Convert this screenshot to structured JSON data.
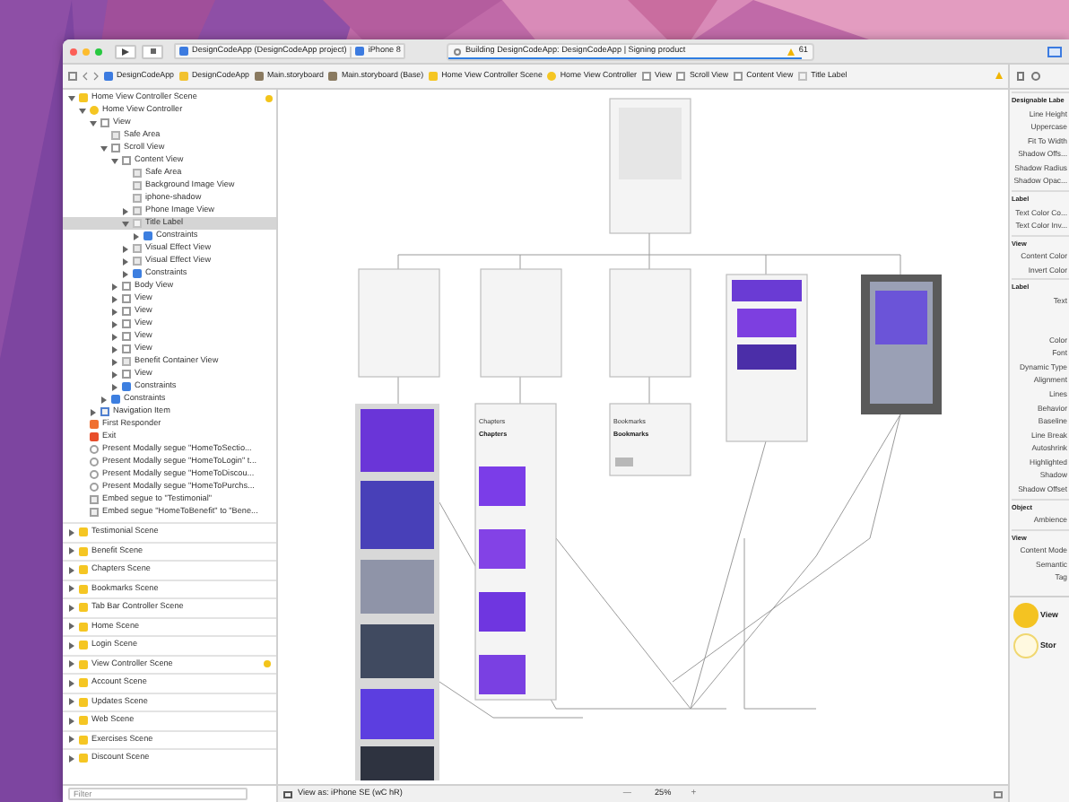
{
  "toolbar": {
    "scheme": "DesignCodeApp (DesignCodeApp project)",
    "device": "iPhone 8",
    "activity": "Building DesignCodeApp: DesignCodeApp | Signing product",
    "level": 0.97,
    "warnings": "61"
  },
  "breadcrumbs": [
    {
      "label": "DesignCodeApp",
      "kind": "project"
    },
    {
      "label": "DesignCodeApp",
      "kind": "folder"
    },
    {
      "label": "Main.storyboard",
      "kind": "file"
    },
    {
      "label": "Main.storyboard (Base)",
      "kind": "file"
    },
    {
      "label": "Home View Controller Scene",
      "kind": "scene"
    },
    {
      "label": "Home View Controller",
      "kind": "controller"
    },
    {
      "label": "View",
      "kind": "view"
    },
    {
      "label": "Scroll View",
      "kind": "view"
    },
    {
      "label": "Content View",
      "kind": "view"
    },
    {
      "label": "Title Label",
      "kind": "label"
    }
  ],
  "outline": {
    "tree": [
      {
        "label": "Home View Controller Scene",
        "kind": "scene",
        "expanded": true,
        "warning": true,
        "selected": false,
        "children": [
          {
            "label": "Home View Controller",
            "kind": "controller",
            "expanded": true,
            "selected": false,
            "children": [
              {
                "label": "View",
                "kind": "view",
                "expanded": true,
                "selected": false,
                "children": [
                  {
                    "label": "Safe Area",
                    "kind": "guide",
                    "selected": false
                  },
                  {
                    "label": "Scroll View",
                    "kind": "view",
                    "expanded": true,
                    "selected": false,
                    "children": [
                      {
                        "label": "Content View",
                        "kind": "view",
                        "expanded": true,
                        "selected": false,
                        "children": [
                          {
                            "label": "Safe Area",
                            "kind": "guide",
                            "selected": false
                          },
                          {
                            "label": "Background Image View",
                            "kind": "guide",
                            "selected": false
                          },
                          {
                            "label": "iphone-shadow",
                            "kind": "guide",
                            "selected": false
                          },
                          {
                            "label": "Phone Image View",
                            "kind": "guide",
                            "expanded": false,
                            "selected": false
                          },
                          {
                            "label": "Title Label",
                            "kind": "label",
                            "expanded": true,
                            "selected": true,
                            "children": [
                              {
                                "label": "Constraints",
                                "kind": "constraints",
                                "expanded": false,
                                "selected": false
                              }
                            ]
                          },
                          {
                            "label": "Visual Effect View",
                            "kind": "guide",
                            "expanded": false,
                            "selected": false
                          },
                          {
                            "label": "Visual Effect View",
                            "kind": "guide",
                            "expanded": false,
                            "selected": false
                          },
                          {
                            "label": "Constraints",
                            "kind": "constraints",
                            "expanded": false,
                            "selected": false
                          }
                        ]
                      },
                      {
                        "label": "Body View",
                        "kind": "view",
                        "expanded": false,
                        "selected": false
                      },
                      {
                        "label": "View",
                        "kind": "view",
                        "expanded": false,
                        "selected": false
                      },
                      {
                        "label": "View",
                        "kind": "view",
                        "expanded": false,
                        "selected": false
                      },
                      {
                        "label": "View",
                        "kind": "view",
                        "expanded": false,
                        "selected": false
                      },
                      {
                        "label": "View",
                        "kind": "view",
                        "expanded": false,
                        "selected": false
                      },
                      {
                        "label": "View",
                        "kind": "view",
                        "expanded": false,
                        "selected": false
                      },
                      {
                        "label": "Benefit Container View",
                        "kind": "guide",
                        "expanded": false,
                        "selected": false
                      },
                      {
                        "label": "View",
                        "kind": "view",
                        "expanded": false,
                        "selected": false
                      },
                      {
                        "label": "Constraints",
                        "kind": "constraints",
                        "expanded": false,
                        "selected": false
                      }
                    ]
                  },
                  {
                    "label": "Constraints",
                    "kind": "constraints",
                    "expanded": false,
                    "selected": false
                  }
                ]
              },
              {
                "label": "Navigation Item",
                "kind": "navigation",
                "expanded": false,
                "selected": false
              }
            ]
          },
          {
            "label": "First Responder",
            "kind": "responder",
            "selected": false
          },
          {
            "label": "Exit",
            "kind": "exit",
            "selected": false
          },
          {
            "label": "Present Modally segue \"HomeToSectio...",
            "kind": "segue",
            "selected": false
          },
          {
            "label": "Present Modally segue \"HomeToLogin\" t...",
            "kind": "segue",
            "selected": false
          },
          {
            "label": "Present Modally segue \"HomeToDiscou...",
            "kind": "segue",
            "selected": false
          },
          {
            "label": "Present Modally segue \"HomeToPurchs...",
            "kind": "segue",
            "selected": false
          },
          {
            "label": "Embed segue to \"Testimonial\"",
            "kind": "embed",
            "selected": false
          },
          {
            "label": "Embed segue \"HomeToBenefit\" to \"Bene...",
            "kind": "embed",
            "selected": false
          }
        ]
      }
    ],
    "scenes": [
      {
        "label": "Testimonial Scene",
        "warning": false
      },
      {
        "label": "Benefit Scene",
        "warning": false
      },
      {
        "label": "Chapters Scene",
        "warning": false
      },
      {
        "label": "Bookmarks Scene",
        "warning": false
      },
      {
        "label": "Tab Bar Controller Scene",
        "warning": false
      },
      {
        "label": "Home Scene",
        "warning": false
      },
      {
        "label": "Login Scene",
        "warning": false
      },
      {
        "label": "View Controller Scene",
        "warning": true
      },
      {
        "label": "Account Scene",
        "warning": false
      },
      {
        "label": "Updates Scene",
        "warning": false
      },
      {
        "label": "Web Scene",
        "warning": false
      },
      {
        "label": "Exercises Scene",
        "warning": false
      },
      {
        "label": "Discount Scene",
        "warning": false
      }
    ],
    "filter": {
      "placeholder": "Filter"
    }
  },
  "canvas": {
    "scenes": [
      {
        "title": "Chapters",
        "heading": "Chapters"
      },
      {
        "title": "Bookmarks",
        "heading": "Bookmarks"
      }
    ]
  },
  "bottom_bar": {
    "view_as": "View as: iPhone SE (wC hR)",
    "zoom_out": "—",
    "zoom": "25%",
    "zoom_in": "+"
  },
  "inspector": {
    "rows": [
      {
        "kind": "header",
        "label": "Designable Labe"
      },
      {
        "kind": "row",
        "label": "Line Height"
      },
      {
        "kind": "row",
        "label": "Uppercase"
      },
      {
        "kind": "row",
        "label": "Fit To Width"
      },
      {
        "kind": "row",
        "label": "Shadow Offs..."
      },
      {
        "kind": "row",
        "label": "Shadow Radius"
      },
      {
        "kind": "row",
        "label": "Shadow Opac..."
      },
      {
        "kind": "header",
        "label": "Label"
      },
      {
        "kind": "row",
        "label": "Text Color Co..."
      },
      {
        "kind": "row",
        "label": "Text Color Inv..."
      },
      {
        "kind": "header",
        "label": "View"
      },
      {
        "kind": "row",
        "label": "Content Color"
      },
      {
        "kind": "row",
        "label": "Invert Color"
      },
      {
        "kind": "header",
        "label": "Label"
      },
      {
        "kind": "row",
        "label": "Text"
      },
      {
        "kind": "gap",
        "label": ""
      },
      {
        "kind": "row",
        "label": "Color"
      },
      {
        "kind": "row",
        "label": "Font"
      },
      {
        "kind": "row",
        "label": "Dynamic Type"
      },
      {
        "kind": "row",
        "label": "Alignment"
      },
      {
        "kind": "row",
        "label": "Lines"
      },
      {
        "kind": "row",
        "label": "Behavior"
      },
      {
        "kind": "row",
        "label": "Baseline"
      },
      {
        "kind": "row",
        "label": "Line Break"
      },
      {
        "kind": "row",
        "label": "Autoshrink"
      },
      {
        "kind": "row",
        "label": "Highlighted"
      },
      {
        "kind": "row",
        "label": "Shadow"
      },
      {
        "kind": "row",
        "label": "Shadow Offset"
      },
      {
        "kind": "header",
        "label": "Object"
      },
      {
        "kind": "row",
        "label": "Ambience"
      },
      {
        "kind": "header",
        "label": "View"
      },
      {
        "kind": "row",
        "label": "Content Mode"
      },
      {
        "kind": "row",
        "label": "Semantic"
      },
      {
        "kind": "row",
        "label": "Tag"
      }
    ],
    "library": [
      {
        "title": "View",
        "kind": "filled"
      },
      {
        "title": "Stor",
        "kind": "outline"
      }
    ]
  }
}
